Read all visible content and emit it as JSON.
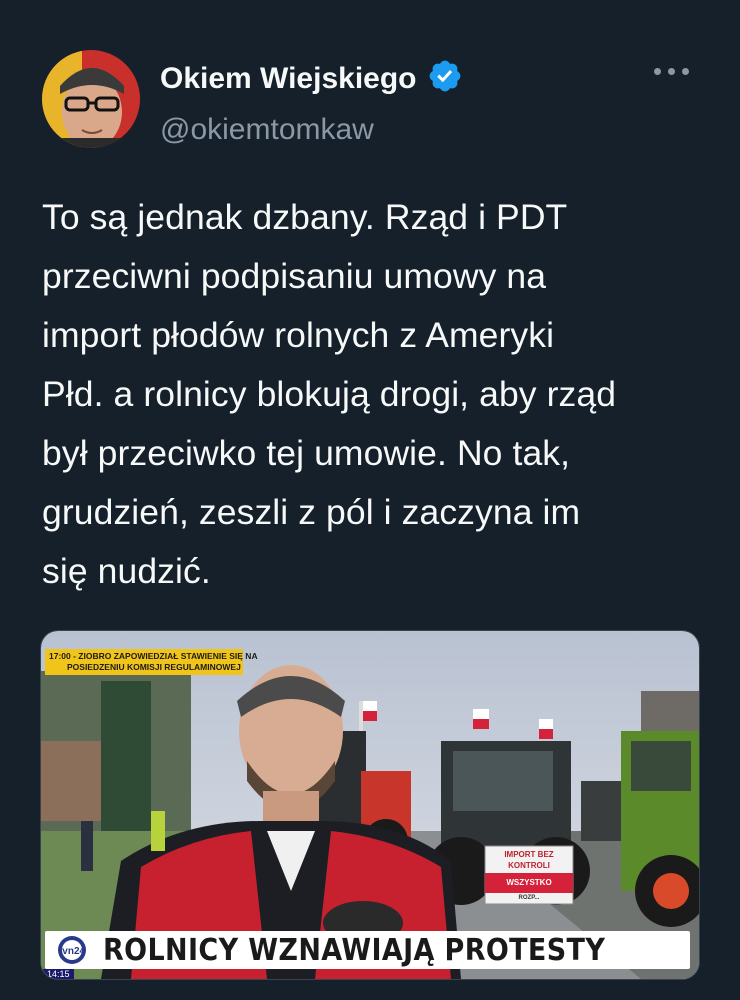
{
  "tweet": {
    "author": {
      "display_name": "Okiem Wiejskiego",
      "handle": "@okiemtomkaw",
      "verified": true
    },
    "text_lines": [
      "To są jednak dzbany. Rząd i PDT",
      "przeciwni podpisaniu umowy na",
      "import płodów rolnych z Ameryki",
      "Płd. a rolnicy blokują drogi, aby rząd",
      "był przeciwko tej umowie. No tak,",
      "grudzień, zeszli z pól i zaczyna im",
      "się nudzić."
    ],
    "more_icon": "more-horizontal-icon"
  },
  "media": {
    "ticker_line1": "17:00 - ZIOBRO ZAPOWIEDZIAŁ STAWIENIE SIĘ NA",
    "ticker_line2": "POSIEDZENIU KOMISJI REGULAMINOWEJ",
    "headline": "ROLNICY WZNAWIAJĄ PROTESTY",
    "logo_text": "tvn24",
    "time_badge": "14:15",
    "sign_line1": "IMPORT BEZ",
    "sign_line2": "KONTROLI",
    "sign_line3": "WSZYSTKO",
    "sign_line4": "ROZP..."
  },
  "colors": {
    "background": "#15202b",
    "text_primary": "#f7f9f9",
    "text_secondary": "#8b98a5",
    "verified_badge": "#1d9bf0",
    "ticker_yellow": "#f0c419"
  }
}
